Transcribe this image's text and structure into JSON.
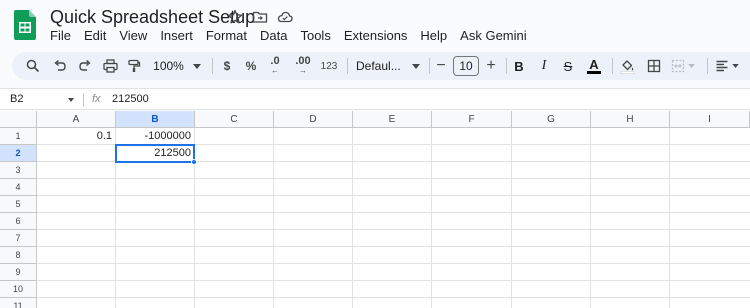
{
  "app": {
    "title": "Quick Spreadsheet Setup",
    "accent": "#0f9d58",
    "selection_color": "#1a73e8"
  },
  "title_icons": [
    "star-icon",
    "move-to-folder-icon",
    "cloud-status-icon"
  ],
  "menu": [
    "File",
    "Edit",
    "View",
    "Insert",
    "Format",
    "Data",
    "Tools",
    "Extensions",
    "Help",
    "Ask Gemini"
  ],
  "toolbar": {
    "zoom": "100%",
    "currency": "$",
    "percent": "%",
    "decrease_decimals": ".0",
    "increase_decimals": ".00",
    "more_formats": "123",
    "font": "Defaul...",
    "font_size": "10",
    "decrease_font": "−",
    "increase_font": "+",
    "bold": "B",
    "italic": "I",
    "strikethrough": "S",
    "text_color": "A"
  },
  "formula_bar": {
    "name_box": "B2",
    "fx": "fx",
    "value": "212500"
  },
  "columns": [
    "A",
    "B",
    "C",
    "D",
    "E",
    "F",
    "G",
    "H",
    "I"
  ],
  "rows": [
    "1",
    "2",
    "3",
    "4",
    "5",
    "6",
    "7",
    "8",
    "9",
    "10",
    "11"
  ],
  "cells": {
    "A1": "0.1",
    "B1": "-1000000",
    "B2": "212500"
  },
  "selected": {
    "cell": "B2",
    "column": "B",
    "row": "2"
  }
}
